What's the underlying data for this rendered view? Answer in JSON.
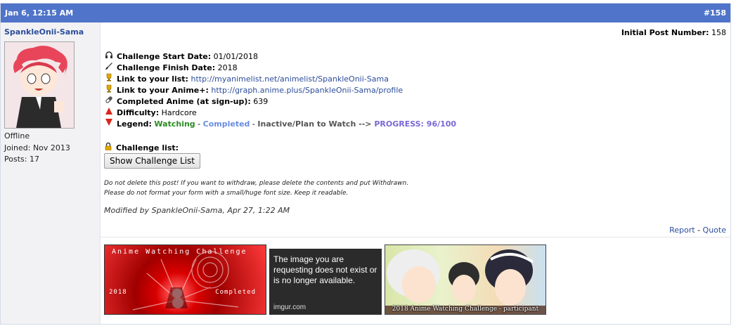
{
  "post": {
    "date": "Jan 6, 12:15 AM",
    "number": "#158"
  },
  "user": {
    "name": "SpankleOnii-Sama",
    "status": "Offline",
    "joined": "Joined: Nov 2013",
    "posts": "Posts: 17"
  },
  "initial_post": {
    "label": "Initial Post Number:",
    "value": "158"
  },
  "challenge": {
    "start_label": "Challenge Start Date:",
    "start_value": "01/01/2018",
    "finish_label": "Challenge Finish Date:",
    "finish_value": "2018",
    "list_label": "Link to your list:",
    "list_url": "http://myanimelist.net/animelist/SpankleOnii-Sama",
    "animeplus_label": "Link to your Anime+:",
    "animeplus_url": "http://graph.anime.plus/SpankleOnii-Sama/profile",
    "completed_label": "Completed Anime (at sign-up):",
    "completed_value": "639",
    "difficulty_label": "Difficulty:",
    "difficulty_value": "Hardcore",
    "legend_label": "Legend:",
    "legend_watching": "Watching",
    "legend_dash1": " - ",
    "legend_completed": "Completed",
    "legend_dash2": " - ",
    "legend_inactive": "Inactive/Plan to Watch",
    "legend_arrow": " --> ",
    "legend_progress": "PROGRESS: 96/100"
  },
  "challenge_list": {
    "label": "Challenge list:",
    "button": "Show Challenge List"
  },
  "notes": {
    "line1": "Do not delete this post! If you want to withdraw, please delete the contents and put Withdrawn.",
    "line2": "Please do not format your form with a small/huge font size. Keep it readable."
  },
  "modified": "Modified by SpankleOnii-Sama, Apr 27, 1:22 AM",
  "actions": {
    "report": "Report",
    "sep": " - ",
    "quote": "Quote"
  },
  "banners": {
    "b1_title": "Anime Watching Challenge",
    "b1_year": "2018",
    "b1_status": "Completed",
    "b2_message": "The image you are requesting does not exist or is no longer available.",
    "b2_source": "imgur.com",
    "b3_caption": "2018 Anime Watching Challenge - participant"
  },
  "icons": {
    "start": "headphones-icon",
    "finish": "paintbrush-icon",
    "list": "trophy-icon",
    "animeplus": "trophy-icon",
    "completed": "pill-icon",
    "difficulty": "up-triangle-icon",
    "legend": "down-triangle-icon",
    "challenge_list": "lock-icon"
  },
  "colors": {
    "header_bg": "#4f74c9",
    "watching": "#2c8a22",
    "completed": "#6a8de0",
    "progress": "#7a68d6",
    "link": "#2c4d9b"
  }
}
